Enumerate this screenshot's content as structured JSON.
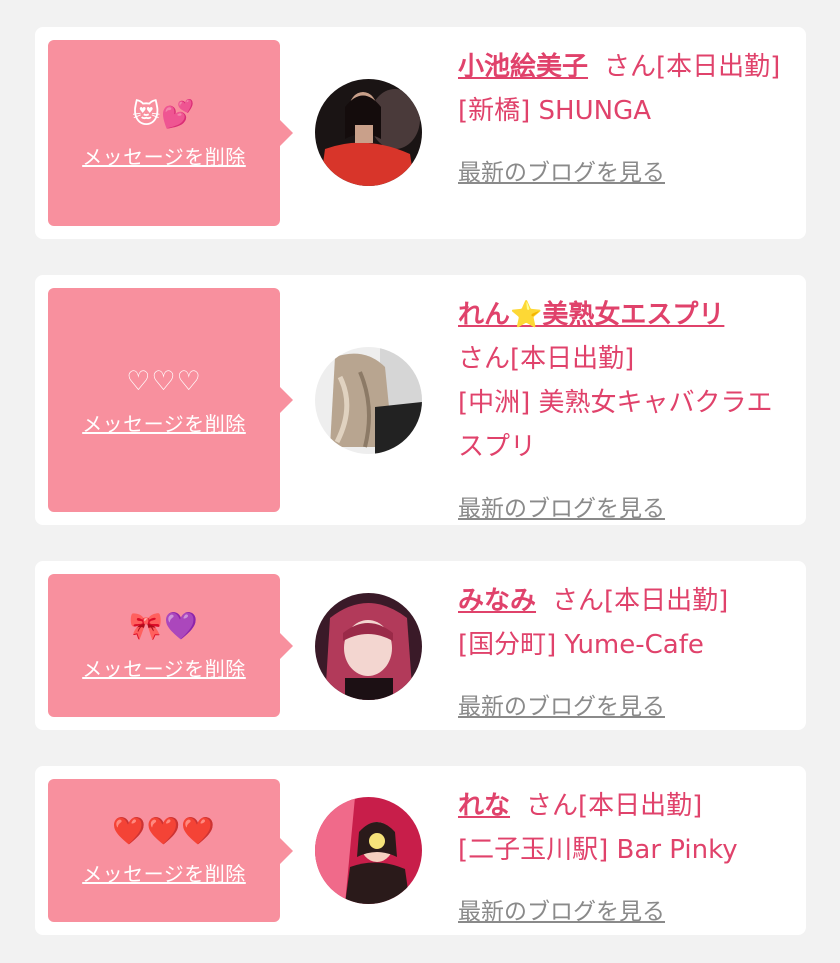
{
  "cards": [
    {
      "message": "😻💕",
      "delete_label": "メッセージを削除",
      "name": "小池絵美子",
      "suffix": "さん[本日出勤]",
      "store": "[新橋] SHUNGA",
      "blog_label": "最新のブログを見る",
      "avatar_colors": [
        "#1a1414",
        "#d8352a",
        "#c9a08a"
      ]
    },
    {
      "message": "♡♡♡",
      "delete_label": "メッセージを削除",
      "name": "れん⭐️美熟女エスプリ",
      "suffix": "さん[本日出勤]",
      "store": "[中洲] 美熟女キャバクラエスプリ",
      "blog_label": "最新のブログを見る",
      "avatar_colors": [
        "#eeeeee",
        "#b8a590",
        "#222222"
      ]
    },
    {
      "message": "🎀💜",
      "delete_label": "メッセージを削除",
      "name": "みなみ",
      "suffix": "さん[本日出勤]",
      "store": "[国分町] Yume-Cafe",
      "blog_label": "最新のブログを見る",
      "avatar_colors": [
        "#3a1a28",
        "#b23a5a",
        "#f3d6d0"
      ]
    },
    {
      "message": "❤️❤️❤️",
      "delete_label": "メッセージを削除",
      "name": "れな",
      "suffix": "さん[本日出勤]",
      "store": "[二子玉川駅] Bar Pinky",
      "blog_label": "最新のブログを見る",
      "avatar_colors": [
        "#c81e4a",
        "#f06a8a",
        "#2a1a1a"
      ]
    }
  ]
}
